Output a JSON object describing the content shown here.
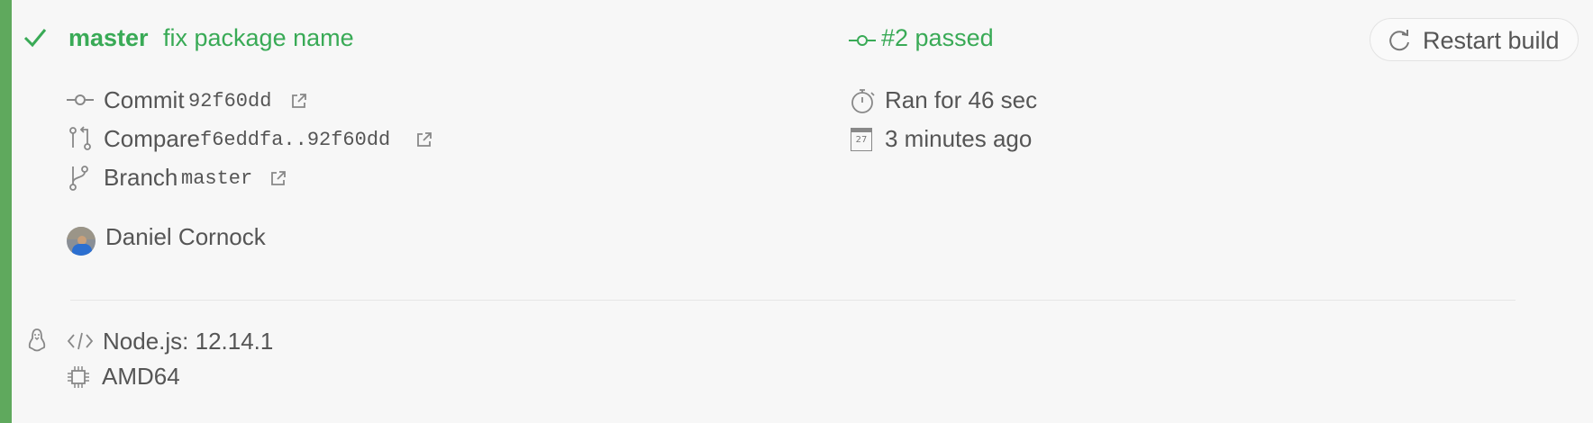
{
  "build": {
    "branch": "master",
    "commit_message": "fix package name",
    "build_label": "#2 passed",
    "restart_label": "Restart build"
  },
  "details": {
    "commit_label": "Commit",
    "commit_sha": "92f60dd",
    "compare_label": "Compare",
    "compare_range": "f6eddfa..92f60dd",
    "branch_label": "Branch",
    "branch_name": "master",
    "author": "Daniel Cornock"
  },
  "timing": {
    "duration": "Ran for 46 sec",
    "calendar_day": "27",
    "ago": "3 minutes ago"
  },
  "job": {
    "language": "Node.js: 12.14.1",
    "arch": "AMD64"
  },
  "icons": {
    "status": "check-icon",
    "commit": "commit-icon",
    "compare": "compare-icon",
    "branch": "branch-icon",
    "external": "external-link-icon",
    "stopwatch": "stopwatch-icon",
    "calendar": "calendar-icon",
    "restart": "restart-icon",
    "os": "linux-icon",
    "code": "code-icon",
    "cpu": "cpu-icon"
  },
  "colors": {
    "passed_green": "#39aa56",
    "status_bar": "#5fa95d",
    "text": "#555555"
  }
}
